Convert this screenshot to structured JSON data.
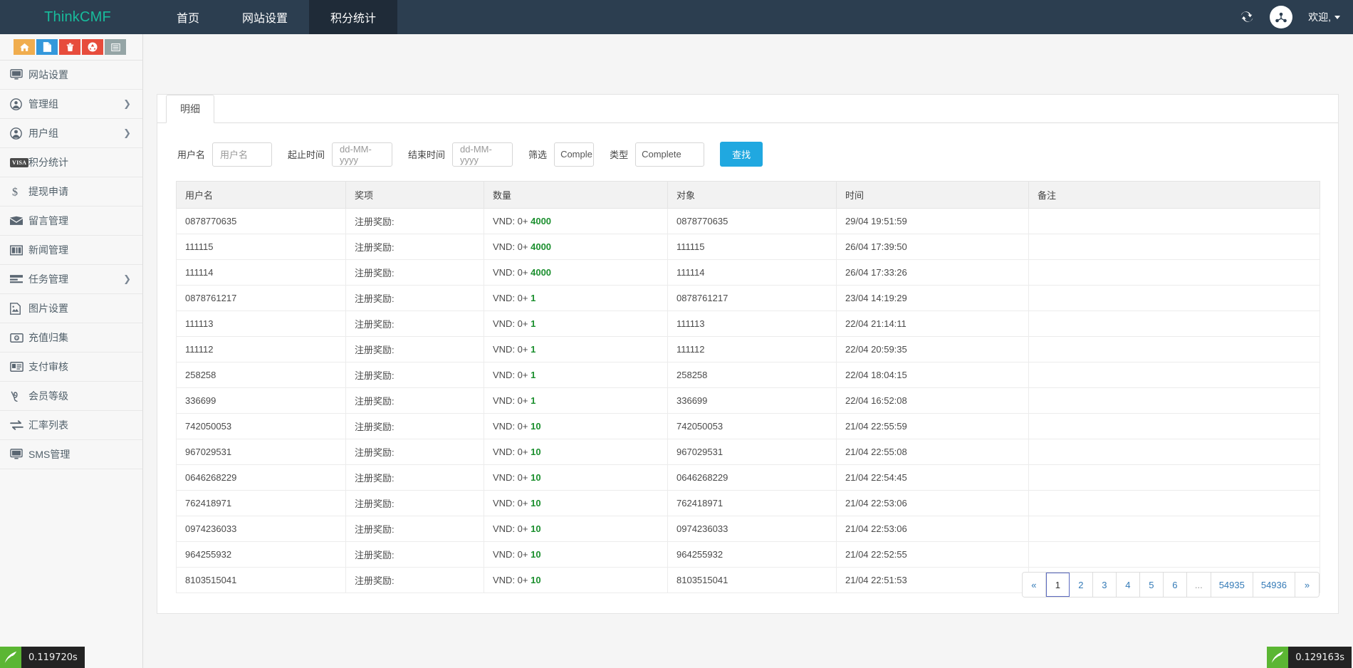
{
  "topbar": {
    "brand": "ThinkCMF",
    "nav": [
      {
        "label": "首页",
        "active": false
      },
      {
        "label": "网站设置",
        "active": false
      },
      {
        "label": "积分统计",
        "active": true
      }
    ],
    "refresh_icon": "refresh-icon",
    "avatar_icon": "user-avatar-icon",
    "welcome": "欢迎,"
  },
  "toolbar": {
    "buttons": [
      {
        "name": "home-button",
        "icon": "home-icon",
        "color": "#f0ad4e"
      },
      {
        "name": "new-file-button",
        "icon": "file-icon",
        "color": "#3498db"
      },
      {
        "name": "delete-button",
        "icon": "trash-icon",
        "color": "#e74c3c"
      },
      {
        "name": "recycle-button",
        "icon": "recycle-icon",
        "color": "#e74c3c"
      },
      {
        "name": "list-button",
        "icon": "list-icon",
        "color": "#95a5a6"
      }
    ]
  },
  "sidebar": {
    "items": [
      {
        "label": "网站设置",
        "icon": "monitor-icon",
        "arrow": false
      },
      {
        "label": "管理组",
        "icon": "user-circle-icon",
        "arrow": true
      },
      {
        "label": "用户组",
        "icon": "user-circle-icon",
        "arrow": true
      },
      {
        "label": "积分统计",
        "icon": "visa-icon",
        "arrow": false
      },
      {
        "label": "提现申请",
        "icon": "dollar-icon",
        "arrow": false
      },
      {
        "label": "留言管理",
        "icon": "envelope-icon",
        "arrow": false
      },
      {
        "label": "新闻管理",
        "icon": "news-icon",
        "arrow": false
      },
      {
        "label": "任务管理",
        "icon": "tasks-icon",
        "arrow": true
      },
      {
        "label": "图片设置",
        "icon": "image-icon",
        "arrow": false
      },
      {
        "label": "充值归集",
        "icon": "money-icon",
        "arrow": false
      },
      {
        "label": "支付审核",
        "icon": "id-card-icon",
        "arrow": false
      },
      {
        "label": "会员等级",
        "icon": "vine-icon",
        "arrow": false
      },
      {
        "label": "汇率列表",
        "icon": "exchange-icon",
        "arrow": false
      },
      {
        "label": "SMS管理",
        "icon": "monitor-icon",
        "arrow": false
      }
    ]
  },
  "panel": {
    "tab_label": "明细",
    "filters": {
      "username_label": "用户名",
      "username_placeholder": "用户名",
      "username_value": "",
      "start_label": "起止时间",
      "start_placeholder": "dd-MM-yyyy",
      "start_value": "",
      "end_label": "结束时间",
      "end_placeholder": "dd-MM-yyyy",
      "end_value": "",
      "filter_label": "筛选",
      "filter_value": "Comple",
      "type_label": "类型",
      "type_value": "Complete",
      "search_button": "查找"
    },
    "table": {
      "columns": [
        "用户名",
        "奖项",
        "数量",
        "对象",
        "时间",
        "备注"
      ],
      "rows": [
        {
          "user": "0878770635",
          "prize": "注册奖励:",
          "amount_prefix": "VND: 0+",
          "amount": "4000",
          "target": "0878770635",
          "time": "29/04 19:51:59",
          "note": ""
        },
        {
          "user": "111115",
          "prize": "注册奖励:",
          "amount_prefix": "VND: 0+",
          "amount": "4000",
          "target": "111115",
          "time": "26/04 17:39:50",
          "note": ""
        },
        {
          "user": "111114",
          "prize": "注册奖励:",
          "amount_prefix": "VND: 0+",
          "amount": "4000",
          "target": "111114",
          "time": "26/04 17:33:26",
          "note": ""
        },
        {
          "user": "0878761217",
          "prize": "注册奖励:",
          "amount_prefix": "VND: 0+",
          "amount": "1",
          "target": "0878761217",
          "time": "23/04 14:19:29",
          "note": ""
        },
        {
          "user": "111113",
          "prize": "注册奖励:",
          "amount_prefix": "VND: 0+",
          "amount": "1",
          "target": "111113",
          "time": "22/04 21:14:11",
          "note": ""
        },
        {
          "user": "111112",
          "prize": "注册奖励:",
          "amount_prefix": "VND: 0+",
          "amount": "1",
          "target": "111112",
          "time": "22/04 20:59:35",
          "note": ""
        },
        {
          "user": "258258",
          "prize": "注册奖励:",
          "amount_prefix": "VND: 0+",
          "amount": "1",
          "target": "258258",
          "time": "22/04 18:04:15",
          "note": ""
        },
        {
          "user": "336699",
          "prize": "注册奖励:",
          "amount_prefix": "VND: 0+",
          "amount": "1",
          "target": "336699",
          "time": "22/04 16:52:08",
          "note": ""
        },
        {
          "user": "742050053",
          "prize": "注册奖励:",
          "amount_prefix": "VND: 0+",
          "amount": "10",
          "target": "742050053",
          "time": "21/04 22:55:59",
          "note": ""
        },
        {
          "user": "967029531",
          "prize": "注册奖励:",
          "amount_prefix": "VND: 0+",
          "amount": "10",
          "target": "967029531",
          "time": "21/04 22:55:08",
          "note": ""
        },
        {
          "user": "0646268229",
          "prize": "注册奖励:",
          "amount_prefix": "VND: 0+",
          "amount": "10",
          "target": "0646268229",
          "time": "21/04 22:54:45",
          "note": ""
        },
        {
          "user": "762418971",
          "prize": "注册奖励:",
          "amount_prefix": "VND: 0+",
          "amount": "10",
          "target": "762418971",
          "time": "21/04 22:53:06",
          "note": ""
        },
        {
          "user": "0974236033",
          "prize": "注册奖励:",
          "amount_prefix": "VND: 0+",
          "amount": "10",
          "target": "0974236033",
          "time": "21/04 22:53:06",
          "note": ""
        },
        {
          "user": "964255932",
          "prize": "注册奖励:",
          "amount_prefix": "VND: 0+",
          "amount": "10",
          "target": "964255932",
          "time": "21/04 22:52:55",
          "note": ""
        },
        {
          "user": "8103515041",
          "prize": "注册奖励:",
          "amount_prefix": "VND: 0+",
          "amount": "10",
          "target": "8103515041",
          "time": "21/04 22:51:53",
          "note": ""
        }
      ]
    },
    "pagination": {
      "prev": "«",
      "next": "»",
      "pages": [
        "1",
        "2",
        "3",
        "4",
        "5",
        "6",
        "...",
        "54935",
        "54936"
      ],
      "current": "1"
    }
  },
  "debug": {
    "left_time": "0.119720s",
    "right_time": "0.129163s"
  },
  "colors": {
    "navbar": "#2c3e50",
    "brand": "#18bc9c",
    "primary": "#20a8e0",
    "amount_green": "#1b8f2e",
    "link": "#337ab7"
  }
}
